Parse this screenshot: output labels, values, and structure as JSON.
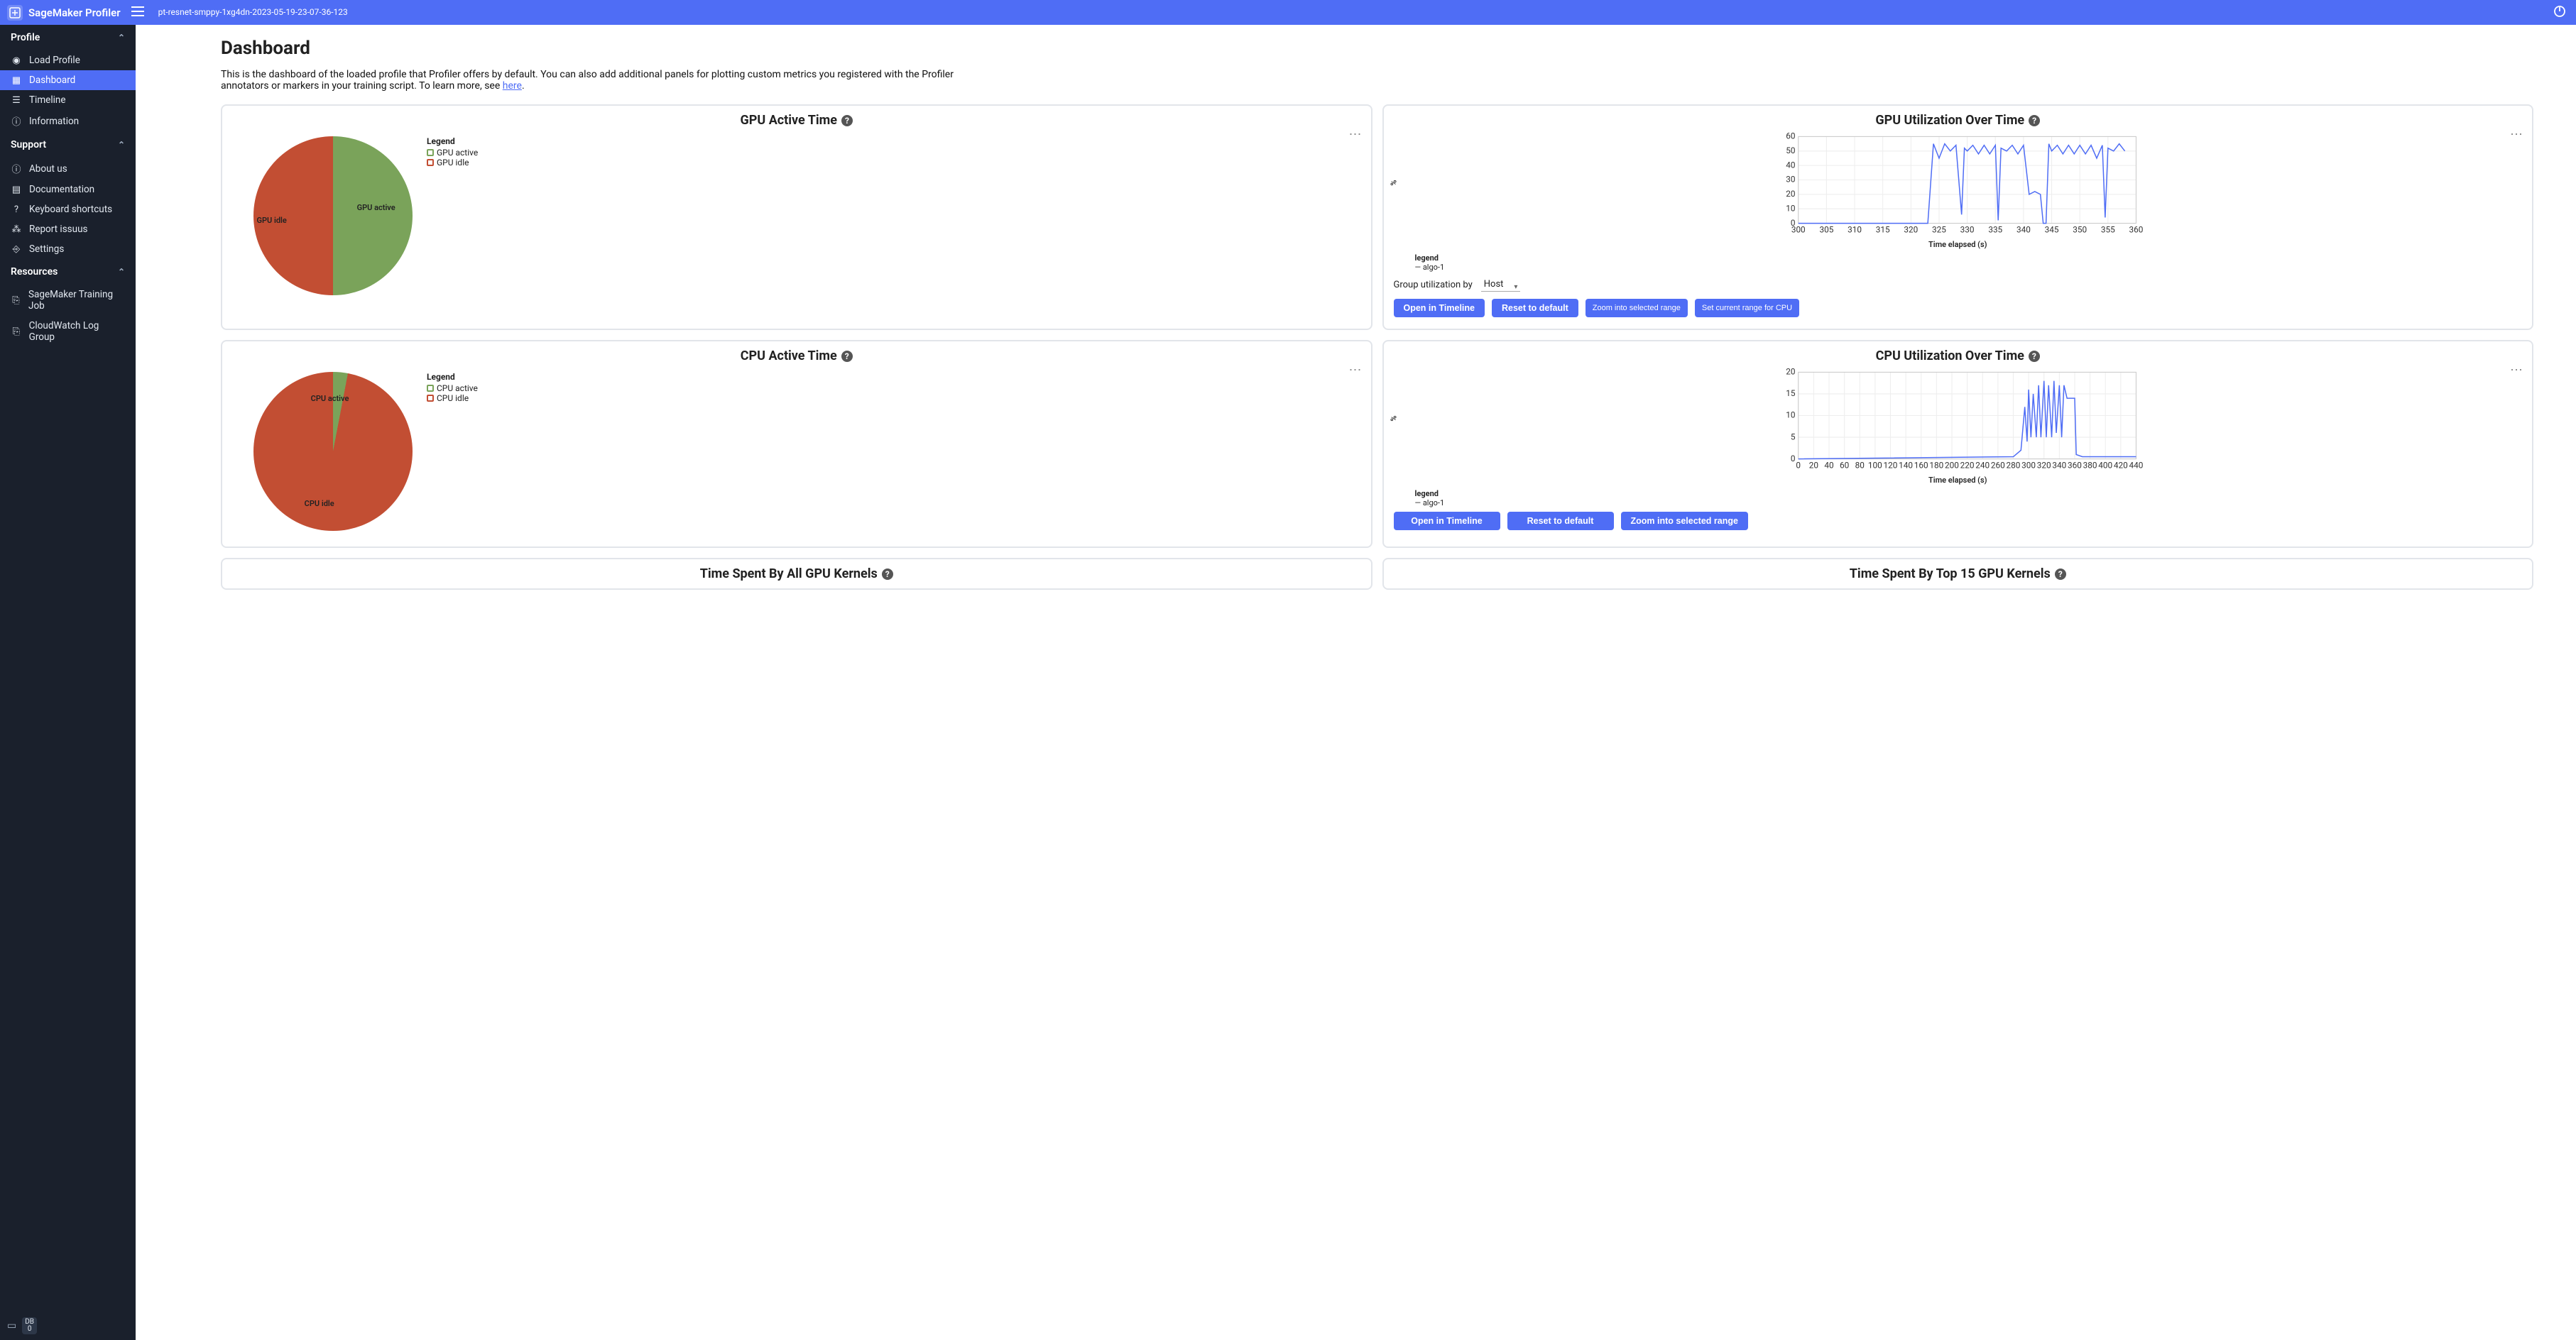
{
  "header": {
    "app_title": "SageMaker Profiler",
    "job_name": "pt-resnet-smppy-1xg4dn-2023-05-19-23-07-36-123"
  },
  "sidebar": {
    "sections": {
      "profile": {
        "label": "Profile",
        "items": [
          {
            "label": "Load Profile",
            "icon": "compass"
          },
          {
            "label": "Dashboard",
            "icon": "dashboard",
            "active": true
          },
          {
            "label": "Timeline",
            "icon": "timeline"
          },
          {
            "label": "Information",
            "icon": "info"
          }
        ]
      },
      "support": {
        "label": "Support",
        "items": [
          {
            "label": "About us",
            "icon": "info"
          },
          {
            "label": "Documentation",
            "icon": "doc"
          },
          {
            "label": "Keyboard shortcuts",
            "icon": "help"
          },
          {
            "label": "Report issuus",
            "icon": "bug"
          },
          {
            "label": "Settings",
            "icon": "settings"
          }
        ]
      },
      "resources": {
        "label": "Resources",
        "items": [
          {
            "label": "SageMaker Training Job",
            "icon": "link"
          },
          {
            "label": "CloudWatch Log Group",
            "icon": "link"
          }
        ]
      }
    },
    "footer_badge": {
      "top": "DB",
      "bottom": "0"
    }
  },
  "page": {
    "title": "Dashboard",
    "description_pre": "This is the dashboard of the loaded profile that Profiler offers by default. You can also add additional panels for plotting custom metrics you registered with the Profiler annotators or markers in your training script. To learn more, see ",
    "description_link": "here",
    "description_post": "."
  },
  "panels": {
    "gpu_active": {
      "title": "GPU Active Time",
      "legend_title": "Legend",
      "legend_items": [
        {
          "label": "GPU active",
          "color": "#7aa35a"
        },
        {
          "label": "GPU idle",
          "color": "#c24e33"
        }
      ],
      "slice_labels": {
        "active": "GPU active",
        "idle": "GPU idle"
      }
    },
    "gpu_util": {
      "title": "GPU Utilization Over Time",
      "ylabel": "%",
      "xlabel": "Time elapsed (s)",
      "legend_title": "legend",
      "legend_series": "algo-1",
      "group_label": "Group utilization by",
      "group_value": "Host",
      "buttons": {
        "open": "Open in Timeline",
        "reset": "Reset to default",
        "zoom": "Zoom into selected range",
        "setcpu": "Set current range for CPU"
      }
    },
    "cpu_active": {
      "title": "CPU Active Time",
      "legend_title": "Legend",
      "legend_items": [
        {
          "label": "CPU active",
          "color": "#7aa35a"
        },
        {
          "label": "CPU idle",
          "color": "#c24e33"
        }
      ],
      "slice_labels": {
        "active": "CPU active",
        "idle": "CPU idle"
      }
    },
    "cpu_util": {
      "title": "CPU Utilization Over Time",
      "ylabel": "%",
      "xlabel": "Time elapsed (s)",
      "legend_title": "legend",
      "legend_series": "algo-1",
      "buttons": {
        "open": "Open in Timeline",
        "reset": "Reset to default",
        "zoom": "Zoom into selected range"
      }
    },
    "gpu_kernels_all": {
      "title": "Time Spent By All GPU Kernels"
    },
    "gpu_kernels_top": {
      "title": "Time Spent By Top 15 GPU Kernels"
    }
  },
  "chart_data": [
    {
      "id": "gpu_active_pie",
      "type": "pie",
      "title": "GPU Active Time",
      "slices": [
        {
          "name": "GPU active",
          "value": 50,
          "color": "#7aa35a"
        },
        {
          "name": "GPU idle",
          "value": 50,
          "color": "#c24e33"
        }
      ]
    },
    {
      "id": "gpu_util_line",
      "type": "line",
      "title": "GPU Utilization Over Time",
      "xlabel": "Time elapsed (s)",
      "ylabel": "%",
      "ylim": [
        0,
        60
      ],
      "xlim": [
        300,
        360
      ],
      "xticks": [
        300,
        305,
        310,
        315,
        320,
        325,
        330,
        335,
        340,
        345,
        350,
        355,
        360
      ],
      "yticks": [
        0,
        10,
        20,
        30,
        40,
        50,
        60
      ],
      "series": [
        {
          "name": "algo-1",
          "color": "#4f6df5",
          "points": [
            [
              300,
              0
            ],
            [
              322,
              0
            ],
            [
              323,
              0
            ],
            [
              324,
              55
            ],
            [
              325,
              45
            ],
            [
              326,
              55
            ],
            [
              327,
              50
            ],
            [
              328,
              54
            ],
            [
              329,
              6
            ],
            [
              329.5,
              52
            ],
            [
              330,
              50
            ],
            [
              331,
              54
            ],
            [
              332,
              48
            ],
            [
              333,
              54
            ],
            [
              334,
              48
            ],
            [
              335,
              54
            ],
            [
              335.5,
              2
            ],
            [
              336,
              52
            ],
            [
              337,
              50
            ],
            [
              338,
              54
            ],
            [
              339,
              48
            ],
            [
              340,
              54
            ],
            [
              341,
              20
            ],
            [
              342,
              22
            ],
            [
              343,
              20
            ],
            [
              343.5,
              0
            ],
            [
              344,
              0
            ],
            [
              344.5,
              55
            ],
            [
              345,
              50
            ],
            [
              346,
              54
            ],
            [
              347,
              48
            ],
            [
              348,
              54
            ],
            [
              349,
              48
            ],
            [
              350,
              54
            ],
            [
              351,
              48
            ],
            [
              352,
              54
            ],
            [
              353,
              45
            ],
            [
              354,
              54
            ],
            [
              354.5,
              4
            ],
            [
              355,
              52
            ],
            [
              356,
              50
            ],
            [
              357,
              55
            ],
            [
              358,
              50
            ]
          ]
        }
      ]
    },
    {
      "id": "cpu_active_pie",
      "type": "pie",
      "title": "CPU Active Time",
      "slices": [
        {
          "name": "CPU active",
          "value": 3,
          "color": "#7aa35a"
        },
        {
          "name": "CPU idle",
          "value": 97,
          "color": "#c24e33"
        }
      ]
    },
    {
      "id": "cpu_util_line",
      "type": "line",
      "title": "CPU Utilization Over Time",
      "xlabel": "Time elapsed (s)",
      "ylabel": "%",
      "ylim": [
        0,
        20
      ],
      "xlim": [
        0,
        440
      ],
      "xticks": [
        0,
        20,
        40,
        60,
        80,
        100,
        120,
        140,
        160,
        180,
        200,
        220,
        240,
        260,
        280,
        300,
        320,
        340,
        360,
        380,
        400,
        420,
        440
      ],
      "yticks": [
        0,
        5,
        10,
        15,
        20
      ],
      "series": [
        {
          "name": "algo-1",
          "color": "#4f6df5",
          "points": [
            [
              0,
              0
            ],
            [
              280,
              0.5
            ],
            [
              290,
              2
            ],
            [
              295,
              12
            ],
            [
              298,
              4
            ],
            [
              300,
              16
            ],
            [
              303,
              5
            ],
            [
              306,
              15
            ],
            [
              310,
              5
            ],
            [
              313,
              17
            ],
            [
              316,
              5
            ],
            [
              320,
              18
            ],
            [
              323,
              5
            ],
            [
              326,
              17
            ],
            [
              330,
              5
            ],
            [
              333,
              18
            ],
            [
              336,
              6
            ],
            [
              340,
              17
            ],
            [
              343,
              5
            ],
            [
              346,
              17
            ],
            [
              350,
              14
            ],
            [
              360,
              14
            ],
            [
              362,
              1
            ],
            [
              370,
              0.5
            ],
            [
              440,
              0.5
            ]
          ]
        }
      ]
    }
  ]
}
